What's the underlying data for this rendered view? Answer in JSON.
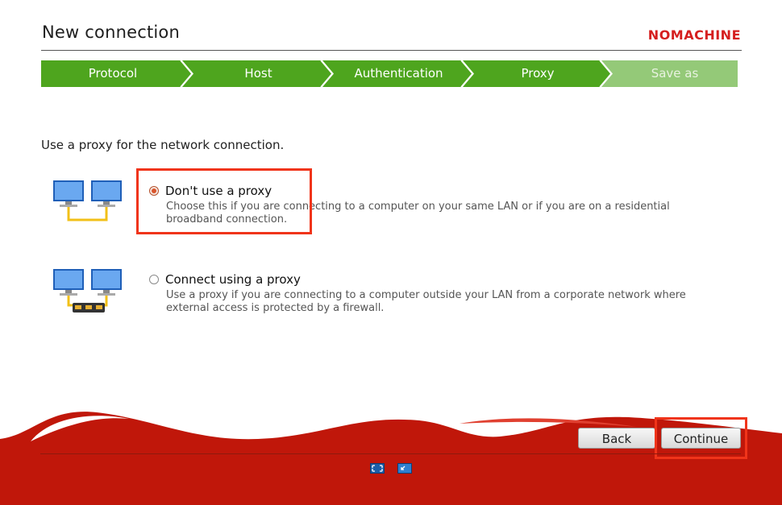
{
  "header": {
    "title": "New connection",
    "logo": "NOMACHINE"
  },
  "steps": [
    {
      "label": "Protocol",
      "state": "done"
    },
    {
      "label": "Host",
      "state": "done"
    },
    {
      "label": "Authentication",
      "state": "done"
    },
    {
      "label": "Proxy",
      "state": "current"
    },
    {
      "label": "Save as",
      "state": "pending"
    }
  ],
  "intro": "Use a proxy for the network connection.",
  "options": [
    {
      "title": "Don't use a proxy",
      "description": "Choose this if you are connecting to a computer on your same LAN or if you are on a residential broadband connection.",
      "selected": true,
      "icon": "lan-computers-icon"
    },
    {
      "title": "Connect using a proxy",
      "description": "Use a proxy if you are connecting to a computer outside your LAN from a corporate network where external access is protected by a firewall.",
      "selected": false,
      "icon": "proxy-computers-icon"
    }
  ],
  "buttons": {
    "back": "Back",
    "continue": "Continue"
  },
  "footer_icons": [
    "fullscreen-icon",
    "window-mode-icon"
  ],
  "colors": {
    "step_active": "#4ea51e",
    "step_pending": "#94c978",
    "brand_red": "#c0170a",
    "highlight": "#f0341a"
  }
}
